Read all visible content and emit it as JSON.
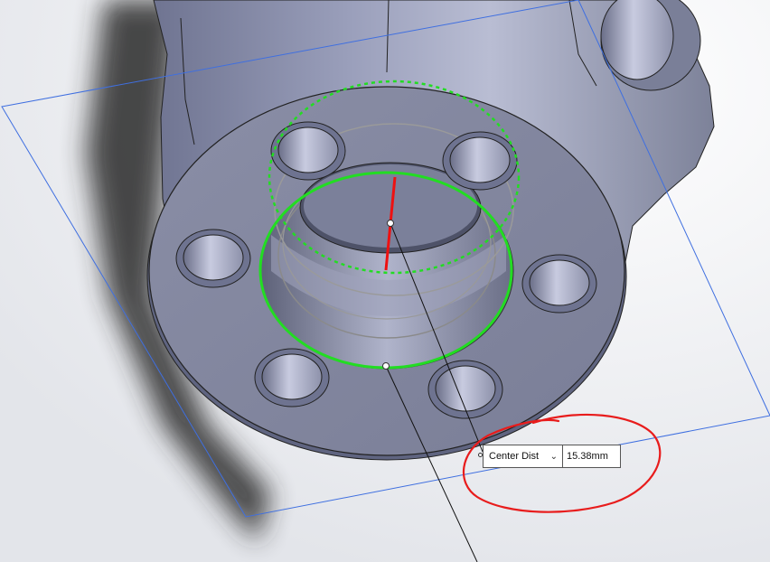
{
  "measure": {
    "mode_label": "Center Dist",
    "value": "15.38mm"
  },
  "colors": {
    "sketch_green": "#22dd22",
    "dimension_red": "#ee1111",
    "annotation_red": "#e81c1c",
    "plane_blue": "#3f6fe0",
    "part_body": "#8e93ad"
  },
  "icons": {
    "dropdown": "chevron-down-icon"
  }
}
